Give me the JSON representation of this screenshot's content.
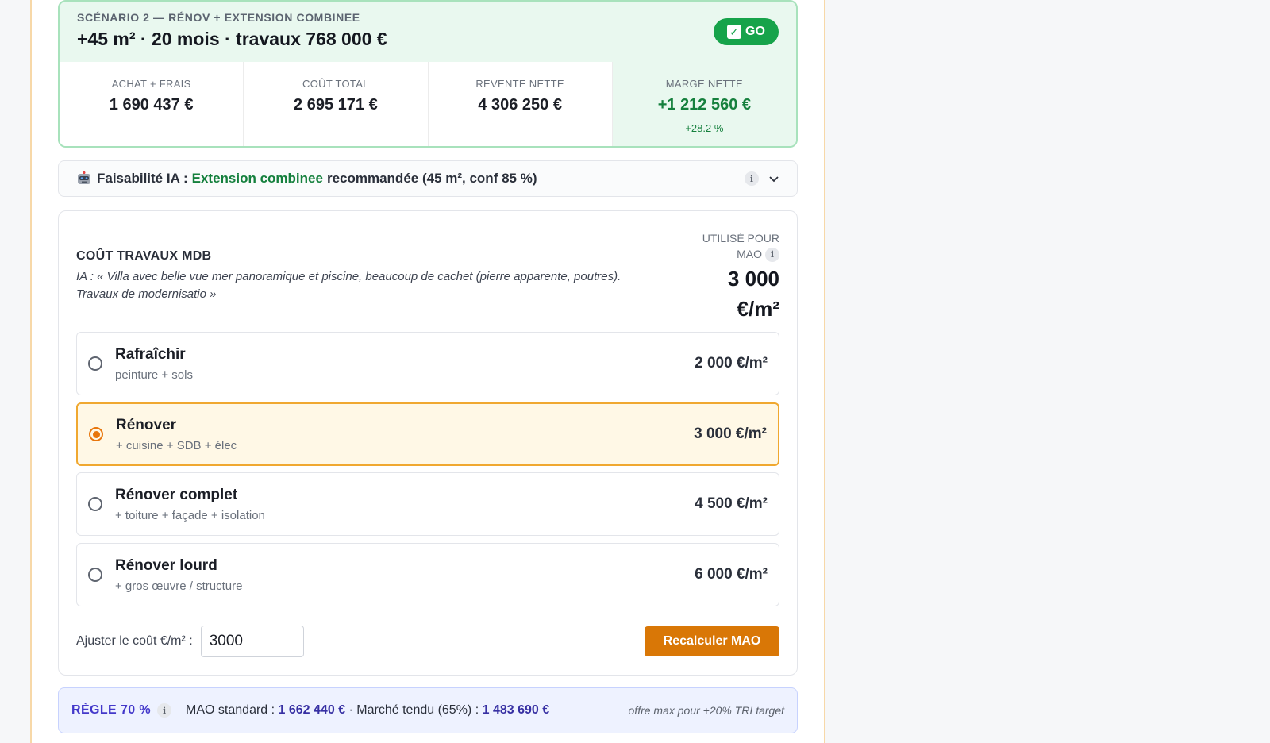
{
  "scenario": {
    "label": "SCÉNARIO 2 — RÉNOV + EXTENSION COMBINEE",
    "title": "+45 m² · 20 mois · travaux 768 000 €",
    "badge_check": "✓",
    "badge_text": "GO",
    "stats": [
      {
        "label": "ACHAT + FRAIS",
        "value": "1 690 437 €"
      },
      {
        "label": "COÛT TOTAL",
        "value": "2 695 171 €"
      },
      {
        "label": "REVENTE NETTE",
        "value": "4 306 250 €"
      },
      {
        "label": "MARGE NETTE",
        "value": "+1 212 560 €",
        "sub": "+28.2 %"
      }
    ]
  },
  "ia": {
    "icon": "robot-icon",
    "label": "Faisabilité IA :",
    "highlight": "Extension combinee",
    "rest": "recommandée (45 m², conf 85 %)",
    "info": "i"
  },
  "cost": {
    "title": "COÛT TRAVAUX MDB",
    "description": "IA : « Villa avec belle vue mer panoramique et piscine, beaucoup de cachet (pierre apparente, poutres). Travaux de modernisatio »",
    "used_label": "UTILISÉ POUR MAO",
    "used_value": "3 000 €/m²",
    "info": "i",
    "options": [
      {
        "name": "Rafraîchir",
        "sub": "peinture + sols",
        "price": "2 000 €/m²",
        "selected": false
      },
      {
        "name": "Rénover",
        "sub": "+ cuisine + SDB + élec",
        "price": "3 000 €/m²",
        "selected": true
      },
      {
        "name": "Rénover complet",
        "sub": "+ toiture + façade + isolation",
        "price": "4 500 €/m²",
        "selected": false
      },
      {
        "name": "Rénover lourd",
        "sub": "+ gros œuvre / structure",
        "price": "6 000 €/m²",
        "selected": false
      }
    ],
    "adjust_label": "Ajuster le coût €/m² :",
    "adjust_value": "3000",
    "recalc_label": "Recalculer MAO"
  },
  "rule": {
    "title": "RÈGLE 70 %",
    "info": "i",
    "mao_label": "MAO standard :",
    "mao_value": "1 662 440 €",
    "sep": "·",
    "tendu_label": "Marché tendu (65%) :",
    "tendu_value": "1 483 690 €",
    "note": "offre max pour +20% TRI target"
  },
  "colors": {
    "accent_green": "#16a34a",
    "accent_orange": "#d97706",
    "accent_indigo": "#4338ca"
  }
}
